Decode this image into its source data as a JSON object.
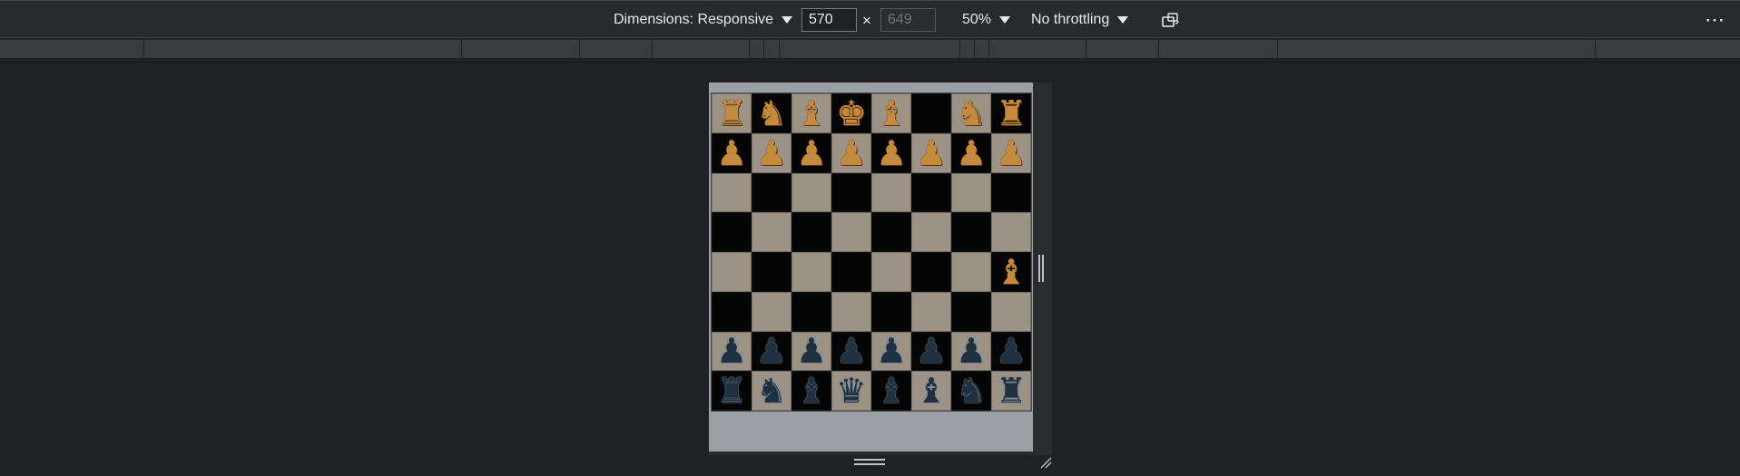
{
  "toolbar": {
    "dimensions_label": "Dimensions: Responsive",
    "width_value": "570",
    "height_placeholder": "649",
    "times": "×",
    "zoom_label": "50%",
    "throttling_label": "No throttling",
    "rotate_icon": "rotate-device-icon",
    "more_label": "⋯"
  },
  "chess": {
    "rows": [
      [
        {
          "p": "♜",
          "c": "white"
        },
        {
          "p": "♞",
          "c": "white"
        },
        {
          "p": "♝",
          "c": "white"
        },
        {
          "p": "♚",
          "c": "white"
        },
        {
          "p": "♝",
          "c": "white"
        },
        {
          "p": "",
          "c": ""
        },
        {
          "p": "♞",
          "c": "white"
        },
        {
          "p": "♜",
          "c": "white"
        }
      ],
      [
        {
          "p": "♟",
          "c": "white"
        },
        {
          "p": "♟",
          "c": "white"
        },
        {
          "p": "♟",
          "c": "white"
        },
        {
          "p": "♟",
          "c": "white"
        },
        {
          "p": "♟",
          "c": "white"
        },
        {
          "p": "♟",
          "c": "white"
        },
        {
          "p": "♟",
          "c": "white"
        },
        {
          "p": "♟",
          "c": "white"
        }
      ],
      [
        {
          "p": "",
          "c": ""
        },
        {
          "p": "",
          "c": ""
        },
        {
          "p": "",
          "c": ""
        },
        {
          "p": "",
          "c": ""
        },
        {
          "p": "",
          "c": ""
        },
        {
          "p": "",
          "c": ""
        },
        {
          "p": "",
          "c": ""
        },
        {
          "p": "",
          "c": ""
        }
      ],
      [
        {
          "p": "",
          "c": ""
        },
        {
          "p": "",
          "c": ""
        },
        {
          "p": "",
          "c": ""
        },
        {
          "p": "",
          "c": ""
        },
        {
          "p": "",
          "c": ""
        },
        {
          "p": "",
          "c": ""
        },
        {
          "p": "",
          "c": ""
        },
        {
          "p": "",
          "c": ""
        }
      ],
      [
        {
          "p": "",
          "c": ""
        },
        {
          "p": "",
          "c": ""
        },
        {
          "p": "",
          "c": ""
        },
        {
          "p": "",
          "c": ""
        },
        {
          "p": "",
          "c": ""
        },
        {
          "p": "",
          "c": ""
        },
        {
          "p": "",
          "c": ""
        },
        {
          "p": "♝",
          "c": "white"
        }
      ],
      [
        {
          "p": "",
          "c": ""
        },
        {
          "p": "",
          "c": ""
        },
        {
          "p": "",
          "c": ""
        },
        {
          "p": "",
          "c": ""
        },
        {
          "p": "",
          "c": ""
        },
        {
          "p": "",
          "c": ""
        },
        {
          "p": "",
          "c": ""
        },
        {
          "p": "",
          "c": ""
        }
      ],
      [
        {
          "p": "♟",
          "c": "black"
        },
        {
          "p": "♟",
          "c": "black"
        },
        {
          "p": "♟",
          "c": "black"
        },
        {
          "p": "♟",
          "c": "black"
        },
        {
          "p": "♟",
          "c": "black"
        },
        {
          "p": "♟",
          "c": "black"
        },
        {
          "p": "♟",
          "c": "black"
        },
        {
          "p": "♟",
          "c": "black"
        }
      ],
      [
        {
          "p": "♜",
          "c": "black"
        },
        {
          "p": "♞",
          "c": "black"
        },
        {
          "p": "♝",
          "c": "black"
        },
        {
          "p": "♛",
          "c": "black"
        },
        {
          "p": "♝",
          "c": "black"
        },
        {
          "p": "♝",
          "c": "black"
        },
        {
          "p": "♞",
          "c": "black"
        },
        {
          "p": "♜",
          "c": "black"
        }
      ]
    ],
    "light_color": "#9c9286",
    "dark_color": "#050505"
  }
}
